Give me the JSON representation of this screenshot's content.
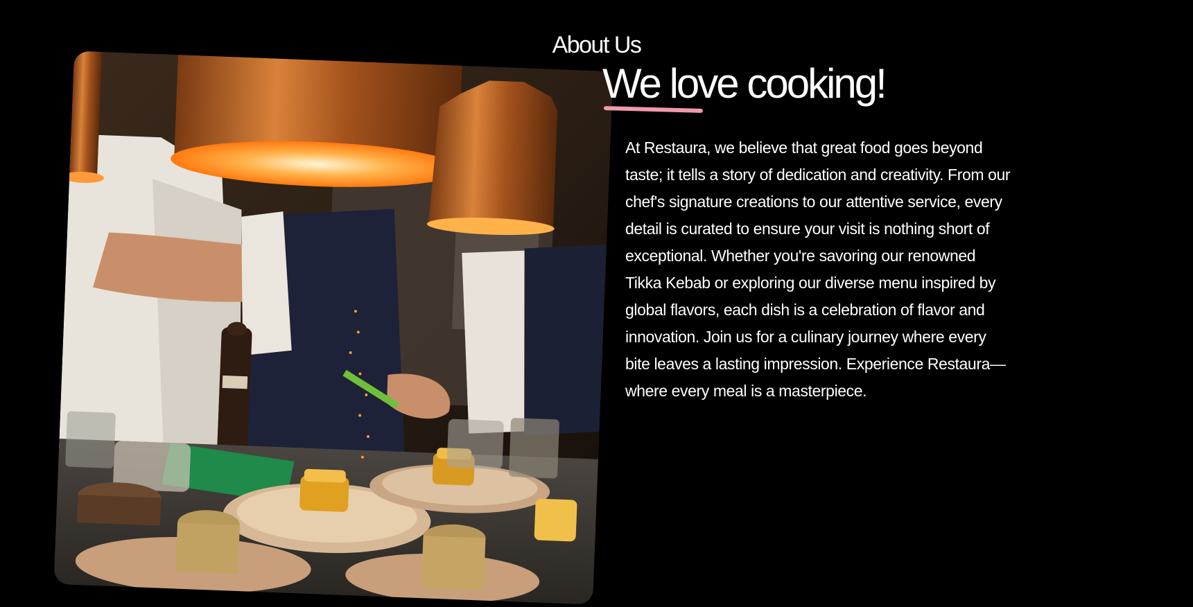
{
  "about": {
    "section_title": "About Us",
    "heading": "We love cooking!",
    "body": "At Restaura, we believe that great food goes beyond taste; it tells a story of dedication and creativity. From our chef's signature creations to our attentive service, every detail is curated to ensure your visit is nothing short of exceptional. Whether you're savoring our renowned Tikka Kebab or exploring our diverse menu inspired by global flavors, each dish is a celebration of flavor and innovation. Join us for a culinary journey where every bite leaves a lasting impression. Experience Restaura—where every meal is a masterpiece.",
    "accent_color": "#f19aa8",
    "background_color": "#000000",
    "text_color": "#ffffff"
  }
}
